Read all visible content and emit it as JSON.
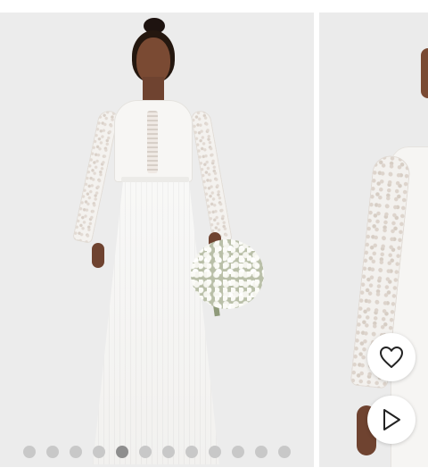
{
  "gallery": {
    "current_index": 5,
    "total_images": 12,
    "active_dot_color": "#8e8e8e",
    "inactive_dot_color": "#c8c8c8"
  },
  "actions": {
    "favorite_icon": "heart-outline-icon",
    "play_icon": "play-triangle-icon"
  }
}
